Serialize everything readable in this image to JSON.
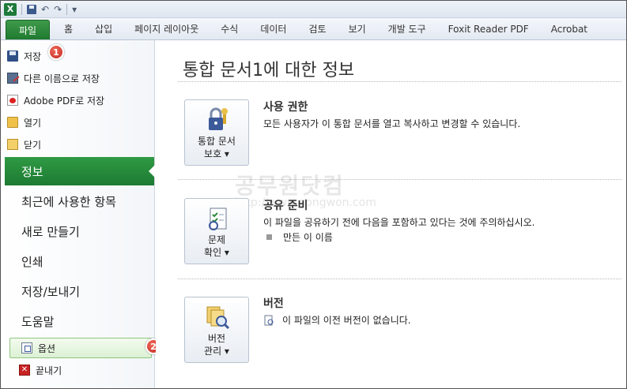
{
  "qat": {
    "app_icon": "X",
    "icons": [
      "save-icon",
      "undo-icon",
      "redo-icon",
      "customize-icon"
    ]
  },
  "tabs": {
    "file": "파일",
    "items": [
      "홈",
      "삽입",
      "페이지 레이아웃",
      "수식",
      "데이터",
      "검토",
      "보기",
      "개발 도구",
      "Foxit Reader PDF",
      "Acrobat"
    ]
  },
  "nav": {
    "small_top": [
      {
        "label": "저장",
        "icon": "save-icon"
      },
      {
        "label": "다른 이름으로 저장",
        "icon": "save-as-icon"
      },
      {
        "label": "Adobe PDF로 저장",
        "icon": "pdf-icon"
      },
      {
        "label": "열기",
        "icon": "folder-open-icon"
      },
      {
        "label": "닫기",
        "icon": "folder-close-icon"
      }
    ],
    "big": [
      "정보",
      "최근에 사용한 항목",
      "새로 만들기",
      "인쇄",
      "저장/보내기",
      "도움말"
    ],
    "active": "정보",
    "options": {
      "label": "옵션",
      "icon": "options-icon"
    },
    "exit": {
      "label": "끝내기",
      "icon": "exit-icon"
    },
    "badges": [
      "1",
      "2"
    ]
  },
  "main": {
    "title": "통합 문서1에 대한 정보",
    "sections": [
      {
        "button_line1": "통합 문서",
        "button_line2": "보호 ▾",
        "title": "사용 권한",
        "desc": "모든 사용자가 이 통합 문서를 열고 복사하고 변경할 수 있습니다."
      },
      {
        "button_line1": "문제",
        "button_line2": "확인 ▾",
        "title": "공유 준비",
        "desc": "이 파일을 공유하기 전에 다음을 포함하고 있다는 것에 주의하십시오.",
        "bullet": "만든 이 이름"
      },
      {
        "button_line1": "버전",
        "button_line2": "관리 ▾",
        "title": "버전",
        "desc": "이 파일의 이전 버전이 없습니다."
      }
    ]
  },
  "watermark": {
    "text": "공무원닷컴",
    "url": "http://www.gongwon.com"
  },
  "colors": {
    "accent_green": "#1d7a32",
    "badge_red": "#c32a22"
  }
}
